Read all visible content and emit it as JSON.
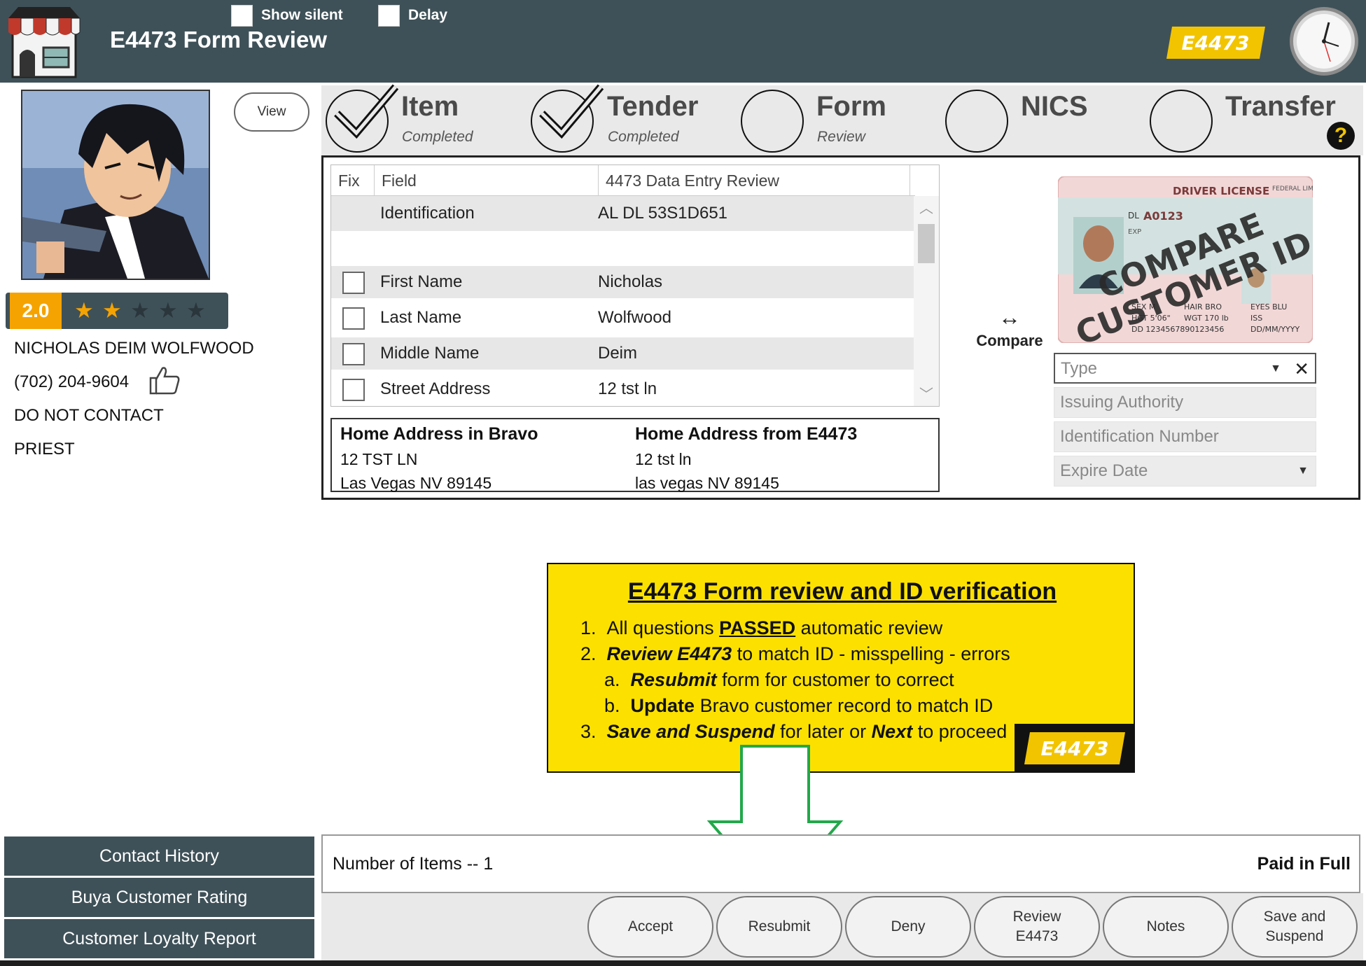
{
  "header": {
    "title": "E4473 Form Review",
    "show_silent_label": "Show silent",
    "delay_label": "Delay",
    "brand_badge": "E4473"
  },
  "customer": {
    "view_label": "View",
    "rating": "2.0",
    "stars_filled": 2,
    "stars_total": 5,
    "name": "NICHOLAS DEIM WOLFWOOD",
    "phone": "(702) 204-9604",
    "contact_pref": "DO NOT CONTACT",
    "occupation": "PRIEST"
  },
  "left_menu": [
    "Contact History",
    "Buya Customer Rating",
    "Customer Loyalty Report"
  ],
  "steps": [
    {
      "title": "Item",
      "subtitle": "Completed",
      "done": true
    },
    {
      "title": "Tender",
      "subtitle": "Completed",
      "done": true
    },
    {
      "title": "Form",
      "subtitle": "Review",
      "done": false
    },
    {
      "title": "NICS",
      "subtitle": "",
      "done": false
    },
    {
      "title": "Transfer",
      "subtitle": "",
      "done": false
    }
  ],
  "help_label": "?",
  "grid": {
    "headers": {
      "fix": "Fix",
      "field": "Field",
      "value": "4473 Data Entry Review"
    },
    "id_row": {
      "field": "Identification",
      "value": "AL DL 53S1D651"
    },
    "rows": [
      {
        "field": "First Name",
        "value": "Nicholas"
      },
      {
        "field": "Last Name",
        "value": "Wolfwood"
      },
      {
        "field": "Middle Name",
        "value": "Deim"
      },
      {
        "field": "Street Address",
        "value": "12 tst ln"
      }
    ]
  },
  "address": {
    "bravo_header": "Home Address in Bravo",
    "bravo_line1": "12 TST LN",
    "bravo_line2": "Las Vegas NV 89145",
    "e4473_header": "Home Address from E4473",
    "e4473_line1": "12 tst ln",
    "e4473_line2": "las vegas NV 89145"
  },
  "compare": {
    "arrow": "↔",
    "label": "Compare"
  },
  "license": {
    "header": "DRIVER LICENSE",
    "federal": "FEDERAL LIMITS APPLY",
    "dl_label": "DL",
    "dl_number": "A0123",
    "exp_label": "EXP",
    "stamp_line1": "COMPARE",
    "stamp_line2": "CUSTOMER ID",
    "sex": "SEX M",
    "hair": "HAIR BRO",
    "eyes": "EYES BLU",
    "hgt": "HGT 5'06\"",
    "wgt": "WGT 170 lb",
    "iss": "ISS",
    "dd": "DD 1234567890123456",
    "date": "DD/MM/YYYY"
  },
  "id_form": {
    "type_placeholder": "Type",
    "issuing_placeholder": "Issuing Authority",
    "number_placeholder": "Identification Number",
    "expire_placeholder": "Expire Date"
  },
  "instructions": {
    "title": "E4473 Form review and ID verification",
    "l1_num": "1.",
    "l1_a": "All questions ",
    "l1_b": "PASSED",
    "l1_c": " automatic review",
    "l2_num": "2.",
    "l2_a": "Review E4473",
    "l2_b": " to match ID - misspelling - errors",
    "l2a_num": "a.",
    "l2a_a": "Resubmit",
    "l2a_b": " form for customer to correct",
    "l2b_num": "b.",
    "l2b_a": "Update",
    "l2b_b": " Bravo customer record to match ID",
    "l3_num": "3.",
    "l3_a": "Save and Suspend",
    "l3_b": " for later or ",
    "l3_c": "Next",
    "l3_d": " to proceed",
    "badge": "E4473"
  },
  "status": {
    "items": "Number of Items -- 1",
    "paid": "Paid in Full"
  },
  "actions": [
    {
      "label": "Accept"
    },
    {
      "label": "Resubmit"
    },
    {
      "label": "Deny"
    },
    {
      "label": "Review\nE4473"
    },
    {
      "label": "Notes"
    },
    {
      "label": "Save and\nSuspend"
    }
  ],
  "colors": {
    "header_bg": "#3f5158",
    "accent_yellow": "#fce100",
    "rating_orange": "#f5a300",
    "arrow_green": "#22a84a"
  }
}
